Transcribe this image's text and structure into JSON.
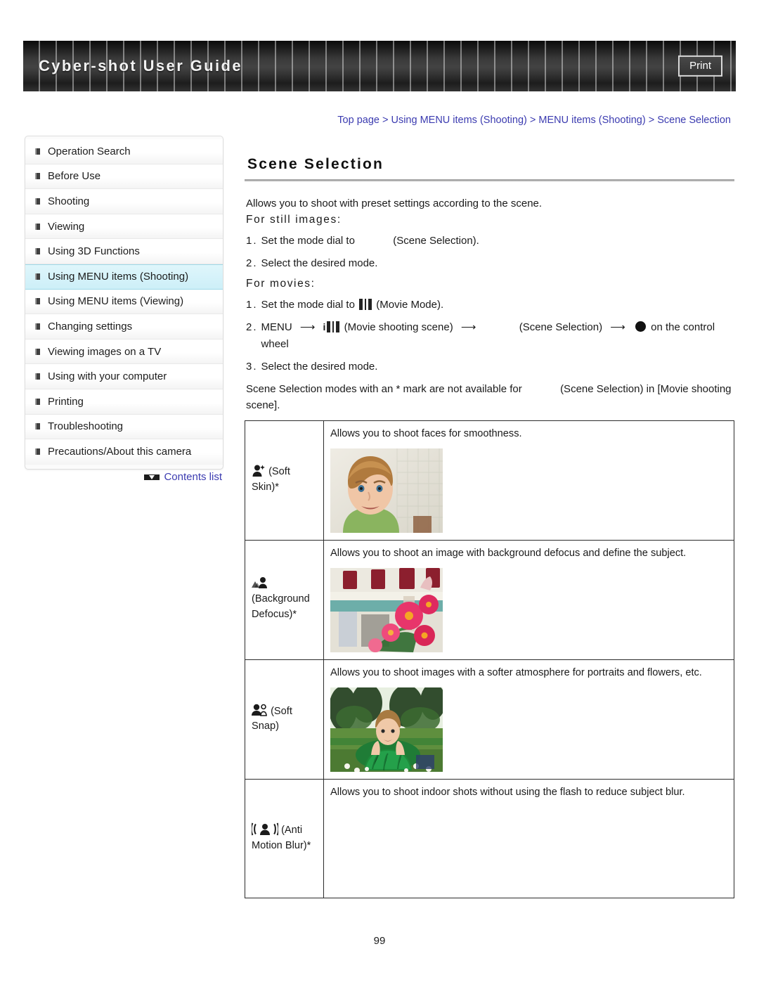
{
  "header": {
    "site_title": "Cyber-shot User Guide",
    "print_label": "Print"
  },
  "breadcrumb": {
    "text": "Top page > Using MENU items (Shooting) > MENU items (Shooting) > Scene Selection"
  },
  "sidebar": {
    "items": [
      {
        "label": "Operation Search",
        "active": false
      },
      {
        "label": "Before Use",
        "active": false
      },
      {
        "label": "Shooting",
        "active": false
      },
      {
        "label": "Viewing",
        "active": false
      },
      {
        "label": "Using 3D Functions",
        "active": false
      },
      {
        "label": "Using MENU items (Shooting)",
        "active": true
      },
      {
        "label": "Using MENU items (Viewing)",
        "active": false
      },
      {
        "label": "Changing settings",
        "active": false
      },
      {
        "label": "Viewing images on a TV",
        "active": false
      },
      {
        "label": "Using with your computer",
        "active": false
      },
      {
        "label": "Printing",
        "active": false
      },
      {
        "label": "Troubleshooting",
        "active": false
      },
      {
        "label": "Precautions/About this camera",
        "active": false
      }
    ],
    "contents_link": "Contents list"
  },
  "main": {
    "title": "Scene Selection",
    "intro": "Allows you to shoot with preset settings according to the scene.",
    "still_heading": "For still images:",
    "still_steps": [
      {
        "num": "1.",
        "pre": "Set the mode dial to",
        "icon": "missing-image",
        "post": "(Scene Selection)."
      },
      {
        "num": "2.",
        "pre": "Select the desired mode.",
        "icon": "",
        "post": ""
      }
    ],
    "movie_heading": "For movies:",
    "movie_steps": [
      {
        "num": "1.",
        "pre": "Set the mode dial to",
        "icon": "film-icon",
        "post": "(Movie Mode)."
      },
      {
        "num": "2.",
        "pre": "MENU",
        "icon": "i-film-icon",
        "mid1": "(Movie shooting scene)",
        "mid2": "(Scene Selection)",
        "icon2": "center-button-icon",
        "post": "on the control wheel"
      },
      {
        "num": "3.",
        "pre": "Select the desired mode.",
        "icon": "",
        "post": ""
      }
    ],
    "note_part1": "Scene Selection modes with an * mark are not available for",
    "note_part2": "(Scene Selection) in [Movie shooting scene]."
  },
  "table": {
    "rows": [
      {
        "icon": "soft-skin-icon",
        "mode": "(Soft Skin)*",
        "description": "Allows you to shoot faces for smoothness.",
        "thumb": "child-portrait-photo"
      },
      {
        "icon": "background-defocus-icon",
        "mode": "(Background Defocus)*",
        "description": "Allows you to shoot an image with background defocus and define the subject.",
        "thumb": "pink-flowers-photo"
      },
      {
        "icon": "soft-snap-icon",
        "mode": "(Soft Snap)",
        "description": "Allows you to shoot images with a softer atmosphere for portraits and flowers, etc.",
        "thumb": "child-on-grass-photo"
      },
      {
        "icon": "anti-motion-blur-icon",
        "mode": "(Anti Motion Blur)*",
        "description": "Allows you to shoot indoor shots without using the flash to reduce subject blur.",
        "thumb": ""
      }
    ]
  },
  "footer": {
    "page_number": "99"
  },
  "colors": {
    "link": "#3b3bb0",
    "active_nav": "#cdeff8",
    "header_dark": "#2d2d2d"
  }
}
